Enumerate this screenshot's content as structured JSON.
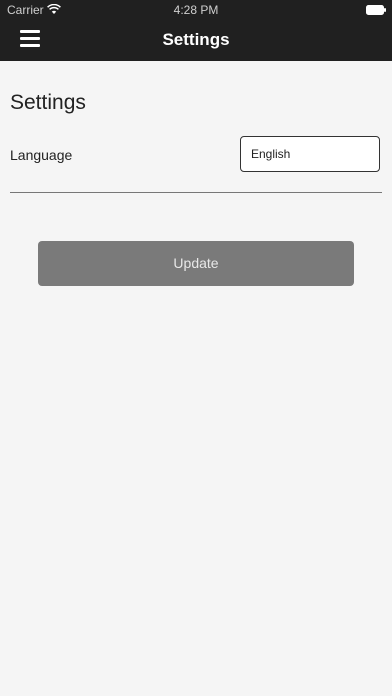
{
  "status_bar": {
    "carrier": "Carrier",
    "time": "4:28 PM",
    "wifi_icon": "wifi-icon",
    "battery_icon": "battery-icon"
  },
  "nav": {
    "title": "Settings",
    "menu_icon": "menu-icon"
  },
  "main": {
    "title": "Settings",
    "language_label": "Language",
    "language_value": "English",
    "update_label": "Update"
  },
  "colors": {
    "nav_background": "#202020",
    "page_background": "#f5f5f5",
    "button_background": "#7a7a7a"
  }
}
